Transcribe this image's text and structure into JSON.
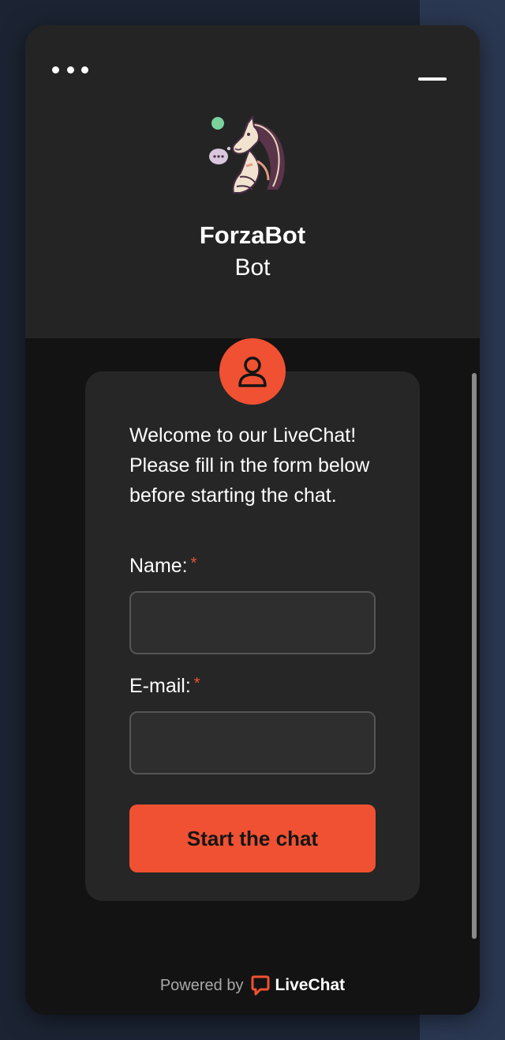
{
  "header": {
    "bot_name": "ForzaBot",
    "bot_role": "Bot",
    "status": "online"
  },
  "form": {
    "welcome_message": "Welcome to our LiveChat! Please fill in the form below before starting the chat.",
    "fields": [
      {
        "label": "Name:",
        "required_mark": "*",
        "value": "",
        "placeholder": ""
      },
      {
        "label": "E-mail:",
        "required_mark": "*",
        "value": "",
        "placeholder": ""
      }
    ],
    "submit_label": "Start the chat"
  },
  "footer": {
    "powered_by": "Powered by",
    "brand_name": "LiveChat"
  },
  "icons": {
    "menu": "more-dots-icon",
    "minimize": "minimize-icon",
    "avatar": "bot-avatar",
    "user": "user-icon",
    "brand": "livechat-logo-icon"
  },
  "colors": {
    "accent": "#f05132",
    "header_bg": "#242424",
    "body_bg": "#131313",
    "card_bg": "#262626",
    "status_online": "#7bd19c"
  }
}
